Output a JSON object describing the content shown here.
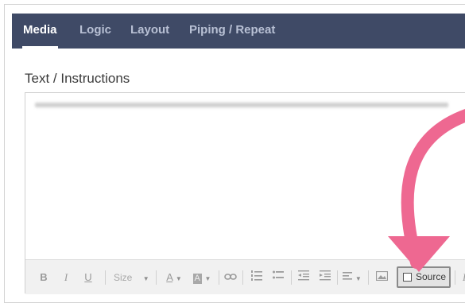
{
  "tabs": [
    {
      "label": "Media",
      "active": true
    },
    {
      "label": "Logic",
      "active": false
    },
    {
      "label": "Layout",
      "active": false
    },
    {
      "label": "Piping / Repeat",
      "active": false
    }
  ],
  "field": {
    "label": "Text / Instructions"
  },
  "toolbar": {
    "bold": "B",
    "italic": "I",
    "underline": "U",
    "size": "Size",
    "font_color": "A",
    "bg_color": "A",
    "source": "Source",
    "next_italic": "I"
  },
  "colors": {
    "tabbar_bg": "#3f4a66",
    "tab_active": "#ffffff",
    "tab_inactive": "#b8c0d4",
    "toolbar_bg": "#f1f1f1",
    "arrow": "#ee6891"
  },
  "icons": {
    "font_color": "text-color-icon",
    "bg_color": "background-color-icon",
    "link": "link-icon",
    "ordered_list": "numbered-list-icon",
    "unordered_list": "bulleted-list-icon",
    "outdent": "outdent-icon",
    "indent": "indent-icon",
    "align": "align-icon",
    "image": "image-icon",
    "source": "source-icon",
    "annotation": "arrow-annotation-icon"
  }
}
